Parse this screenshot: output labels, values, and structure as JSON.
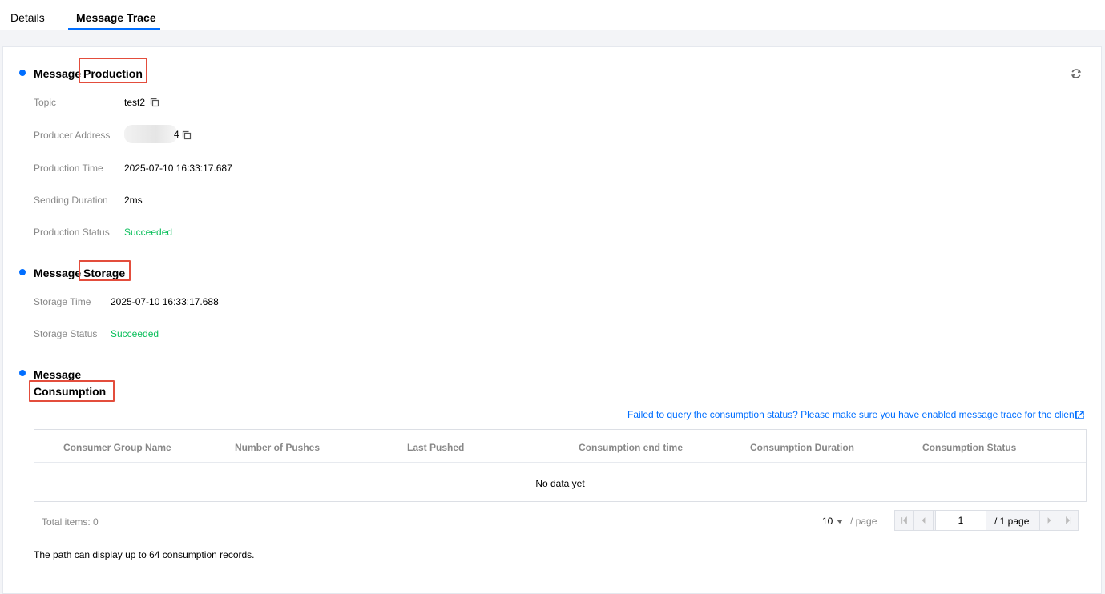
{
  "tabs": [
    {
      "label": "Details"
    },
    {
      "label": "Message Trace"
    }
  ],
  "production": {
    "title_prefix": "Message",
    "title_highlight": "Production",
    "fields": {
      "topic_label": "Topic",
      "topic_value": "test2",
      "producer_address_label": "Producer Address",
      "producer_address_value": "4",
      "production_time_label": "Production Time",
      "production_time_value": "2025-07-10 16:33:17.687",
      "sending_duration_label": "Sending Duration",
      "sending_duration_value": "2ms",
      "production_status_label": "Production Status",
      "production_status_value": "Succeeded"
    }
  },
  "storage": {
    "title_prefix": "Message",
    "title_highlight": "Storage",
    "fields": {
      "storage_time_label": "Storage Time",
      "storage_time_value": "2025-07-10 16:33:17.688",
      "storage_status_label": "Storage Status",
      "storage_status_value": "Succeeded"
    }
  },
  "consumption": {
    "title_prefix": "Message",
    "title_highlight": "Consumption",
    "help_link": "Failed to query the consumption status? Please make sure you have enabled message trace for the client.",
    "table": {
      "columns": [
        "Consumer Group Name",
        "Number of Pushes",
        "Last Pushed",
        "Consumption end time",
        "Consumption Duration",
        "Consumption Status"
      ],
      "empty_text": "No data yet"
    },
    "pagination": {
      "total_label": "Total items:  0",
      "page_size": "10",
      "per_page_label": "/ page",
      "current_page": "1",
      "total_pages_label": "/ 1 page"
    },
    "note": "The path can display up to 64 consumption records."
  },
  "colors": {
    "accent": "#006eff",
    "success": "#0abf5b",
    "highlight_box": "#e34d3c"
  },
  "icons": [
    "refresh-icon",
    "copy-icon",
    "external-link-icon",
    "first-page-icon",
    "prev-page-icon",
    "next-page-icon",
    "last-page-icon",
    "caret-down-icon"
  ]
}
